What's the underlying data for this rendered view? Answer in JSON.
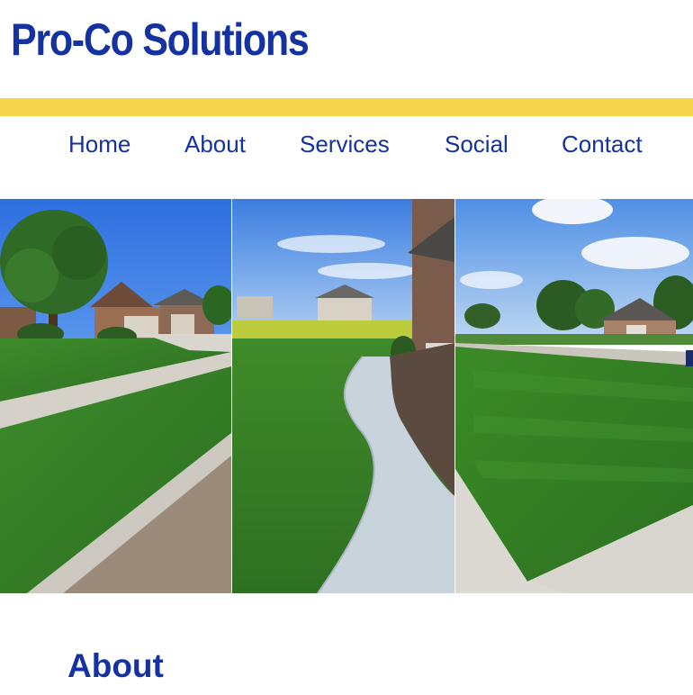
{
  "header": {
    "brand": "Pro-Co Solutions"
  },
  "nav": {
    "items": [
      {
        "label": "Home"
      },
      {
        "label": "About"
      },
      {
        "label": "Services"
      },
      {
        "label": "Social"
      },
      {
        "label": "Contact"
      }
    ]
  },
  "gallery": {
    "photos": [
      {
        "subject": "lawn-with-house-and-tree"
      },
      {
        "subject": "curved-sidewalk-lawn"
      },
      {
        "subject": "wide-lawn-with-trees"
      }
    ]
  },
  "about": {
    "heading": "About"
  },
  "colors": {
    "brand_blue": "#1432a0",
    "accent_yellow": "#f7d54a",
    "background": "#ffffff",
    "grass": "#3f8a2a",
    "sky": "#3a7fe0"
  }
}
